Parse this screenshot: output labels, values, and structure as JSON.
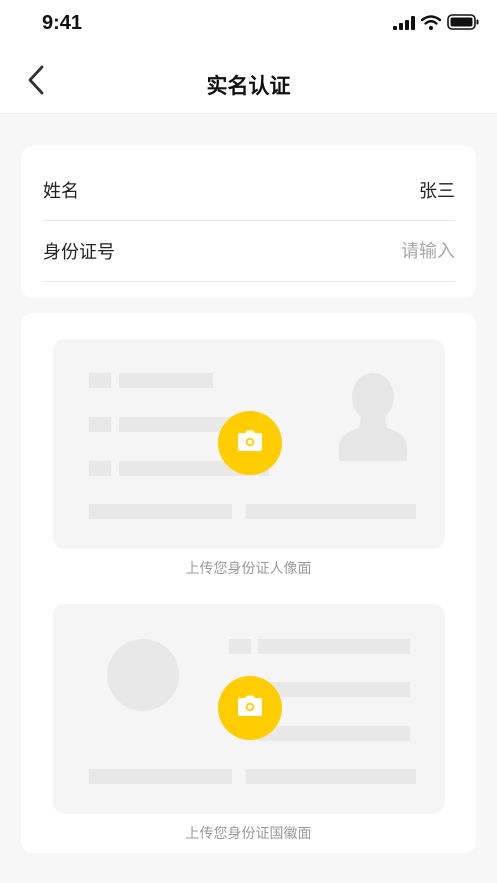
{
  "status_bar": {
    "time": "9:41",
    "icons": [
      "cellular-signal-icon",
      "wifi-icon",
      "battery-icon"
    ]
  },
  "nav": {
    "back_icon": "chevron-left-icon",
    "title": "实名认证"
  },
  "form": {
    "name_label": "姓名",
    "name_value": "张三",
    "id_label": "身份证号",
    "id_value": "",
    "id_placeholder": "请输入"
  },
  "upload": {
    "front": {
      "label": "上传您身份证人像面",
      "icon": "camera-icon"
    },
    "back": {
      "label": "上传您身份证国徽面",
      "icon": "camera-icon"
    }
  },
  "colors": {
    "accent": "#ffcd00",
    "page_background": "#f7f7f7",
    "card_background": "#ffffff",
    "placeholder_panel": "#f5f5f5",
    "placeholder_shape": "#e8e8e8",
    "muted_text": "#9a9a9a"
  }
}
